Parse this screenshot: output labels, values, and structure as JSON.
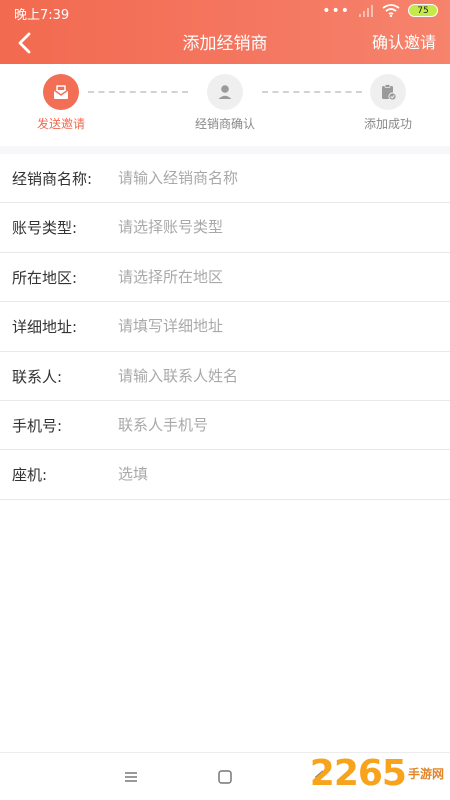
{
  "status": {
    "time": "晚上7:39",
    "battery": "75"
  },
  "header": {
    "title": "添加经销商",
    "action": "确认邀请"
  },
  "steps": [
    {
      "label": "发送邀请",
      "icon": "mail-icon"
    },
    {
      "label": "经销商确认",
      "icon": "person-icon"
    },
    {
      "label": "添加成功",
      "icon": "clipboard-check-icon"
    }
  ],
  "form": [
    {
      "label": "经销商名称:",
      "placeholder": "请输入经销商名称"
    },
    {
      "label": "账号类型:",
      "placeholder": "请选择账号类型"
    },
    {
      "label": "所在地区:",
      "placeholder": "请选择所在地区"
    },
    {
      "label": "详细地址:",
      "placeholder": "请填写详细地址"
    },
    {
      "label": "联系人:",
      "placeholder": "请输入联系人姓名"
    },
    {
      "label": "手机号:",
      "placeholder": "联系人手机号"
    },
    {
      "label": "座机:",
      "placeholder": "选填"
    }
  ],
  "watermark": {
    "number": "2265",
    "text": "手游网"
  },
  "colors": {
    "accent": "#f26a4f",
    "inactive_step": "#efefef",
    "placeholder": "#a9a9a9"
  }
}
